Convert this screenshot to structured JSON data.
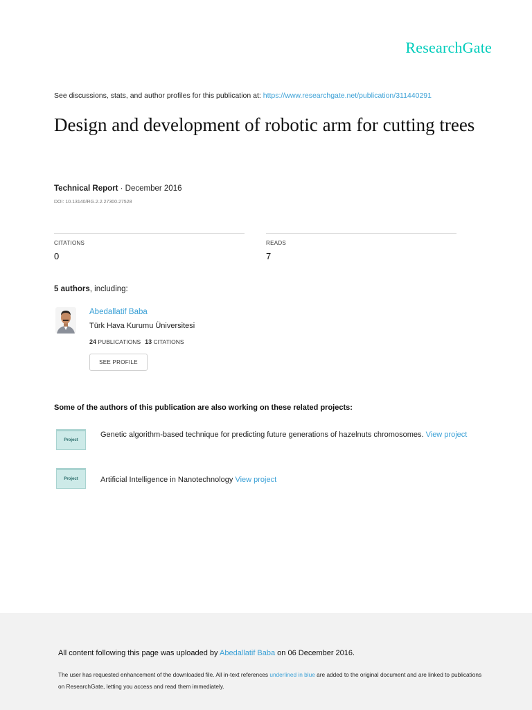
{
  "brand": {
    "name": "ResearchGate"
  },
  "header": {
    "see_text": "See discussions, stats, and author profiles for this publication at: ",
    "url": "https://www.researchgate.net/publication/311440291"
  },
  "publication": {
    "title": "Design and development of robotic arm for cutting trees",
    "type": "Technical Report",
    "date": " · December 2016",
    "doi": "DOI: 10.13140/RG.2.2.27300.27528"
  },
  "stats": {
    "citations_label": "CITATIONS",
    "citations_value": "0",
    "reads_label": "READS",
    "reads_value": "7"
  },
  "authors": {
    "count": "5 authors",
    "suffix": ", including:",
    "items": [
      {
        "name": "Abedallatif Baba",
        "institution": "Türk Hava Kurumu Üniversitesi",
        "publications_count": "24",
        "publications_label": "PUBLICATIONS",
        "citations_count": "13",
        "citations_label": "CITATIONS",
        "profile_button": "SEE PROFILE"
      }
    ]
  },
  "related": {
    "heading": "Some of the authors of this publication are also working on these related projects:",
    "projects": [
      {
        "icon_label": "Project",
        "title": "Genetic algorithm-based technique for predicting future generations of hazelnuts chromosomes. ",
        "link": "View project"
      },
      {
        "icon_label": "Project",
        "title": "Artificial Intelligence in Nanotechnology ",
        "link": "View project"
      }
    ]
  },
  "footer": {
    "uploaded_prefix": "All content following this page was uploaded by ",
    "uploader": "Abedallatif Baba",
    "uploaded_suffix": " on 06 December 2016.",
    "note_prefix": "The user has requested enhancement of the downloaded file. All in-text references ",
    "note_link": "underlined in blue",
    "note_suffix": " are added to the original document and are linked to publications on ResearchGate, letting you access and read them immediately."
  },
  "colors": {
    "brand": "#00ccbb",
    "link": "#3aa0d6",
    "footer_bg": "#f2f2f2",
    "project_icon": "#cdeae8"
  }
}
